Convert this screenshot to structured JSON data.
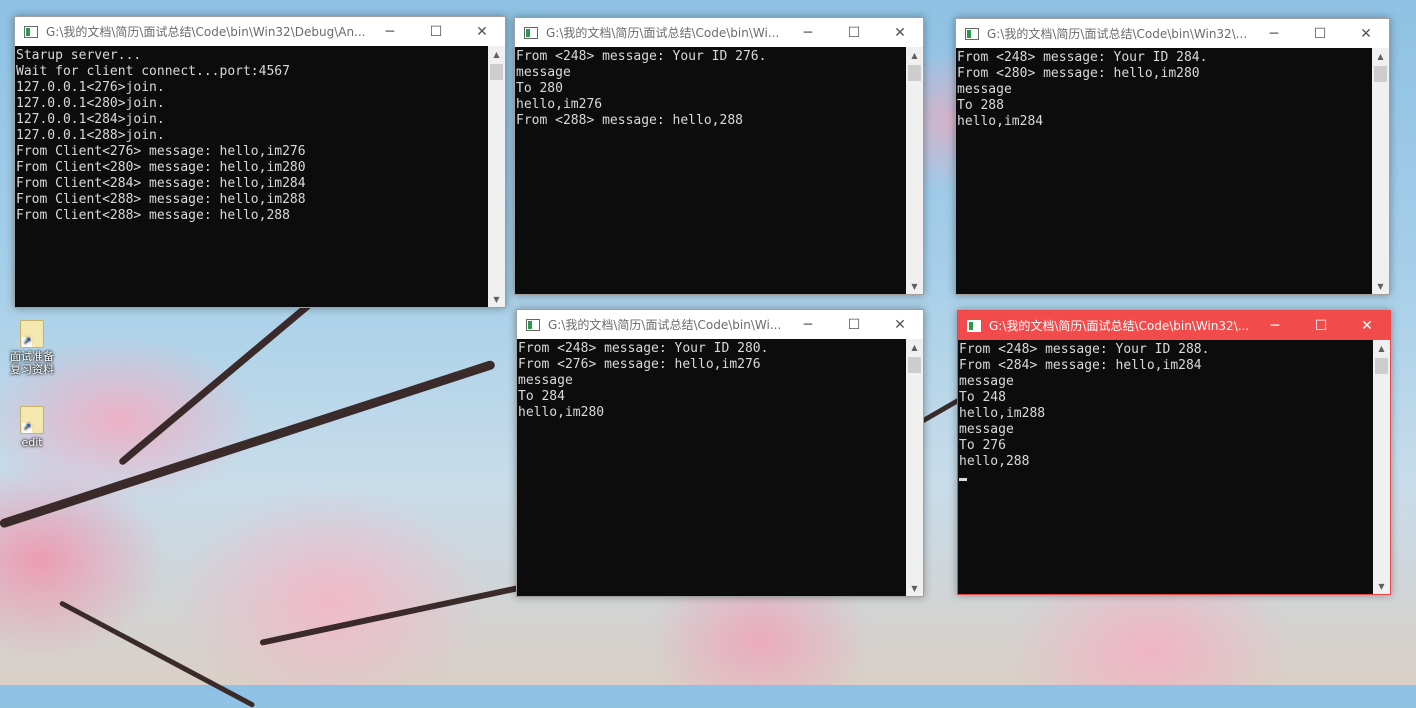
{
  "desktop": {
    "icons": [
      {
        "label": "面试准备\n复习资料"
      },
      {
        "label": "edit"
      }
    ]
  },
  "windows": [
    {
      "title": "G:\\我的文档\\简历\\面试总结\\Code\\bin\\Win32\\Debug\\An...",
      "lines": [
        "Starup server...",
        "Wait for client connect...port:4567",
        "127.0.0.1<276>join.",
        "127.0.0.1<280>join.",
        "127.0.0.1<284>join.",
        "127.0.0.1<288>join.",
        "From Client<276> message: hello,im276",
        "From Client<280> message: hello,im280",
        "From Client<284> message: hello,im284",
        "From Client<288> message: hello,im288",
        "From Client<288> message: hello,288"
      ]
    },
    {
      "title": "G:\\我的文档\\简历\\面试总结\\Code\\bin\\Wi...",
      "lines": [
        "From <248> message: Your ID 276.",
        "message",
        "To 280",
        "hello,im276",
        "From <288> message: hello,288"
      ]
    },
    {
      "title": "G:\\我的文档\\简历\\面试总结\\Code\\bin\\Win32\\...",
      "lines": [
        "From <248> message: Your ID 284.",
        "From <280> message: hello,im280",
        "message",
        "To 288",
        "hello,im284"
      ]
    },
    {
      "title": "G:\\我的文档\\简历\\面试总结\\Code\\bin\\Wi...",
      "lines": [
        "From <248> message: Your ID 280.",
        "From <276> message: hello,im276",
        "message",
        "To 284",
        "hello,im280"
      ]
    },
    {
      "title": "G:\\我的文档\\简历\\面试总结\\Code\\bin\\Win32\\...",
      "lines": [
        "From <248> message: Your ID 288.",
        "From <284> message: hello,im284",
        "message",
        "To 248",
        "hello,im288",
        "message",
        "To 276",
        "hello,288"
      ]
    }
  ],
  "controls": {
    "minimize": "─",
    "maximize": "☐",
    "close": "✕",
    "scroll_up": "▲",
    "scroll_down": "▼"
  }
}
